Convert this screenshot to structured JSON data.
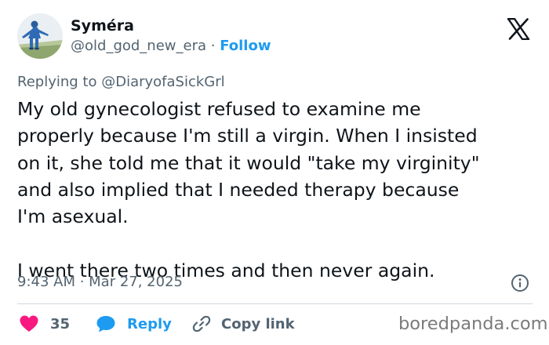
{
  "user": {
    "display_name": "Syméra",
    "handle": "@old_god_new_era",
    "separator": " · ",
    "follow_label": "Follow",
    "avatar_icon": "blue-costume-figure-avatar"
  },
  "header": {
    "logo_icon": "x-logo-icon"
  },
  "reply_context": {
    "prefix": "Replying to ",
    "mention": "@DiaryofaSickGrl"
  },
  "tweet": {
    "text": "My old gynecologist refused to examine me\nproperly because I'm still a virgin. When I insisted\non it, she told me that it would \"take my virginity\"\nand also implied that I needed therapy because\nI'm asexual.\n\nI went there two times and then never again.",
    "timestamp": "9:43 AM · Mar 27, 2025"
  },
  "actions": {
    "like_count": "35",
    "reply_label": "Reply",
    "copy_link_label": "Copy link"
  },
  "colors": {
    "accent": "#1d9bf0",
    "like": "#f91880",
    "secondary_text": "#536471",
    "divider": "#cfd9de"
  },
  "watermark": "boredpanda.com"
}
